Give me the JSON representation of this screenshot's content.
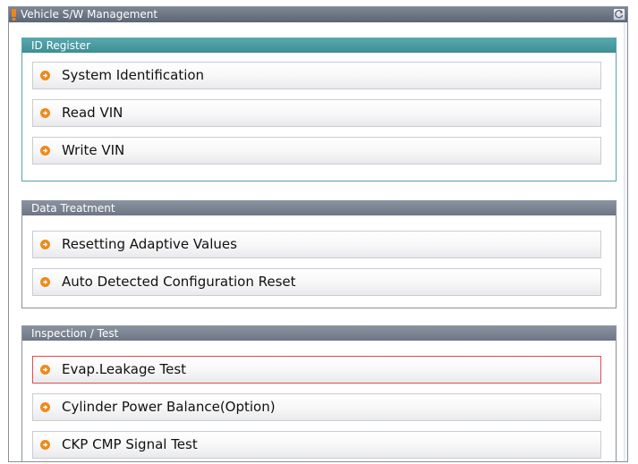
{
  "window": {
    "title": "Vehicle S/W Management"
  },
  "groups": [
    {
      "title": "ID Register",
      "items": [
        {
          "label": "System Identification"
        },
        {
          "label": "Read VIN"
        },
        {
          "label": "Write VIN"
        }
      ]
    },
    {
      "title": "Data Treatment",
      "items": [
        {
          "label": "Resetting Adaptive Values"
        },
        {
          "label": "Auto Detected Configuration Reset"
        }
      ]
    },
    {
      "title": "Inspection / Test",
      "items": [
        {
          "label": "Evap.Leakage Test",
          "selected": true
        },
        {
          "label": "Cylinder Power Balance(Option)"
        },
        {
          "label": "CKP CMP Signal Test"
        }
      ]
    }
  ],
  "colors": {
    "group_header_teal": "#4a9da2",
    "group_header_gray": "#7c8594",
    "selection_border": "#e14d4d",
    "bullet": "#f08a1c"
  },
  "icons": {
    "title": "warning-marker-icon",
    "refresh": "refresh-icon",
    "bullet": "orange-arrow-bullet-icon"
  }
}
